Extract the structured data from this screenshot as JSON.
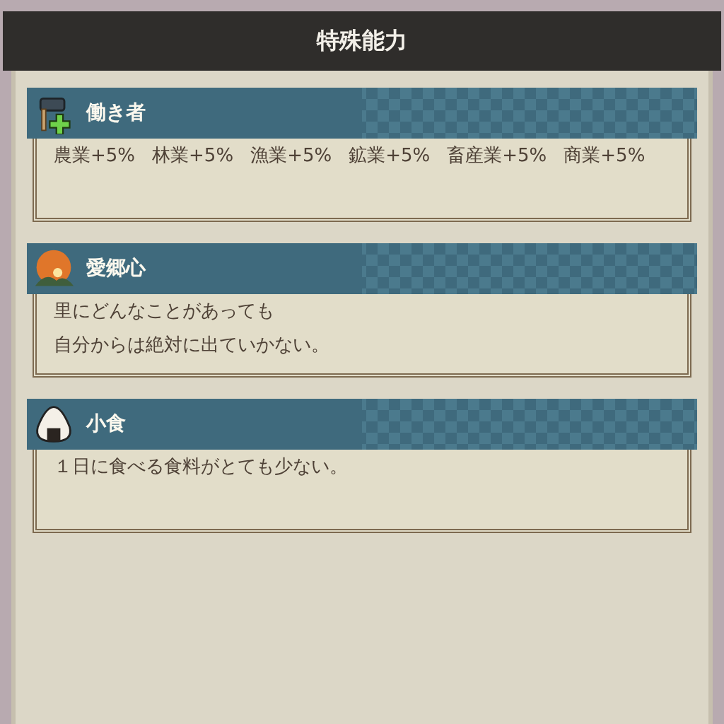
{
  "title": "特殊能力",
  "abilities": [
    {
      "kind": "tool",
      "name": "働き者",
      "effects": [
        "農業+5%",
        "林業+5%",
        "漁業+5%",
        "鉱業+5%",
        "畜産業+5%",
        "商業+5%"
      ]
    },
    {
      "kind": "sunset",
      "name": "愛郷心",
      "lines": [
        "里にどんなことがあっても",
        "自分からは絶対に出ていかない。"
      ]
    },
    {
      "kind": "riceball",
      "name": "小食",
      "lines": [
        "１日に食べる食料がとても少ない。"
      ]
    }
  ]
}
